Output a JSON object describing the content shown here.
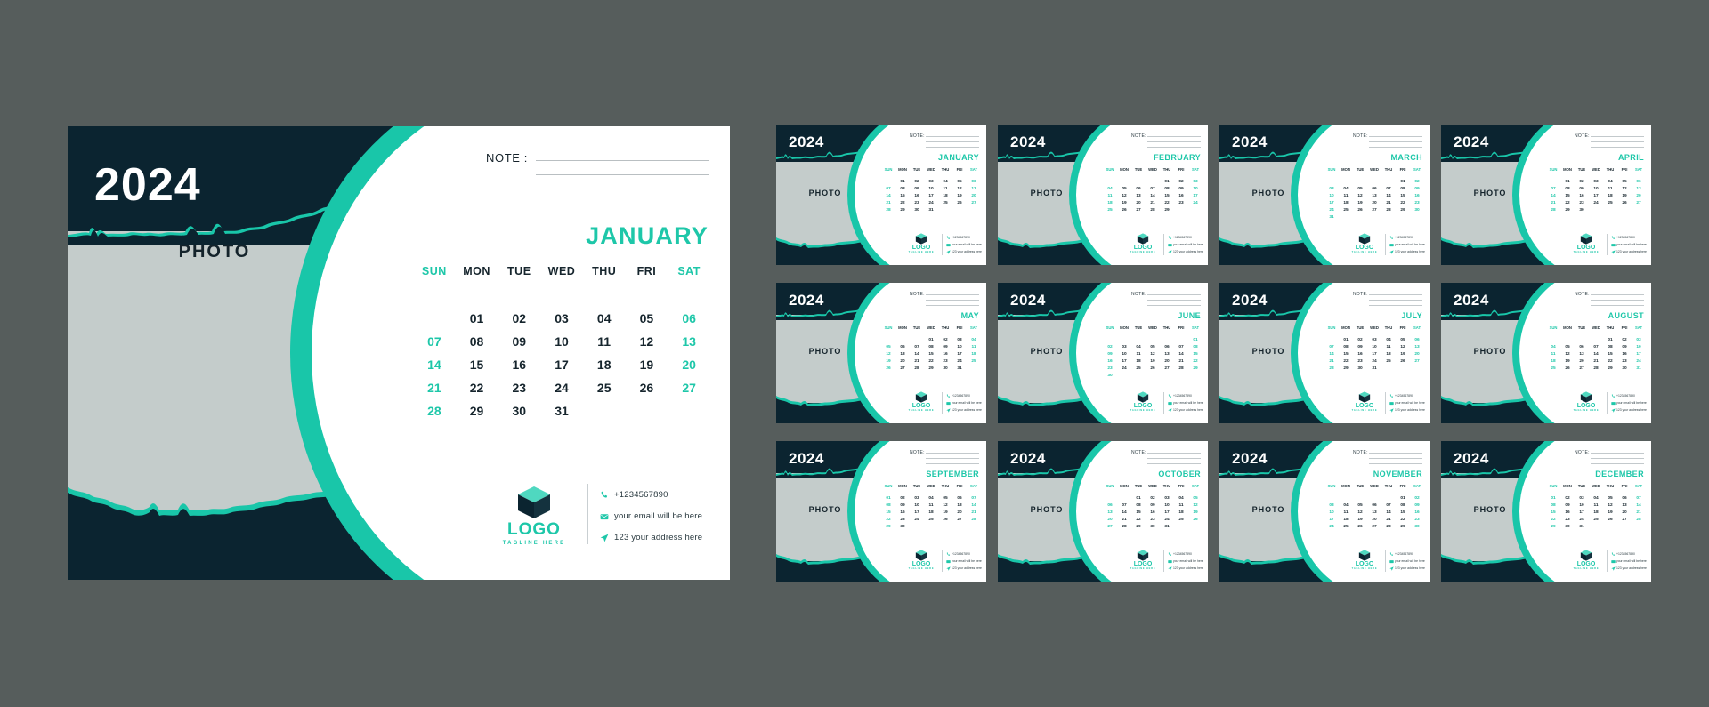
{
  "theme": {
    "background": "#565d5c",
    "dark_navy": "#0b2430",
    "teal": "#19c6a9",
    "teal_text": "#1ec7a9",
    "photo_gray": "#c4cccb",
    "paper": "#ffffff"
  },
  "main": {
    "year": "2024",
    "photo_label": "PHOTO",
    "note_label": "NOTE :",
    "month": "JANUARY",
    "weekdays": [
      "SUN",
      "MON",
      "TUE",
      "WED",
      "THU",
      "FRI",
      "SAT"
    ],
    "weekend_indices": [
      0,
      6
    ],
    "days": [
      "",
      "01",
      "02",
      "03",
      "04",
      "05",
      "06",
      "07",
      "08",
      "09",
      "10",
      "11",
      "12",
      "13",
      "14",
      "15",
      "16",
      "17",
      "18",
      "19",
      "20",
      "21",
      "22",
      "23",
      "24",
      "25",
      "26",
      "27",
      "28",
      "29",
      "30",
      "31",
      "",
      "",
      ""
    ],
    "logo": {
      "icon": "cube-icon",
      "word": "LOGO",
      "tagline": "TAGLINE HERE"
    },
    "contacts": [
      {
        "icon": "phone-icon",
        "text": "+1234567890"
      },
      {
        "icon": "envelope-icon",
        "text": "your email will be here"
      },
      {
        "icon": "location-arrow-icon",
        "text": "123 your address here"
      }
    ],
    "note_lines": 3
  },
  "thumbnails": [
    {
      "year": "2024",
      "photo_label": "PHOTO",
      "note_label": "NOTE:",
      "month": "JANUARY",
      "days": [
        "",
        "01",
        "02",
        "03",
        "04",
        "05",
        "06",
        "07",
        "08",
        "09",
        "10",
        "11",
        "12",
        "13",
        "14",
        "15",
        "16",
        "17",
        "18",
        "19",
        "20",
        "21",
        "22",
        "23",
        "24",
        "25",
        "26",
        "27",
        "28",
        "29",
        "30",
        "31",
        "",
        "",
        ""
      ]
    },
    {
      "year": "2024",
      "photo_label": "PHOTO",
      "note_label": "NOTE:",
      "month": "FEBRUARY",
      "days": [
        "",
        "",
        "",
        "",
        "01",
        "02",
        "03",
        "04",
        "05",
        "06",
        "07",
        "08",
        "09",
        "10",
        "11",
        "12",
        "13",
        "14",
        "15",
        "16",
        "17",
        "18",
        "19",
        "20",
        "21",
        "22",
        "23",
        "24",
        "25",
        "26",
        "27",
        "28",
        "29",
        "",
        ""
      ]
    },
    {
      "year": "2024",
      "photo_label": "PHOTO",
      "note_label": "NOTE:",
      "month": "MARCH",
      "days": [
        "",
        "",
        "",
        "",
        "",
        "01",
        "02",
        "03",
        "04",
        "05",
        "06",
        "07",
        "08",
        "09",
        "10",
        "11",
        "12",
        "13",
        "14",
        "15",
        "16",
        "17",
        "18",
        "19",
        "20",
        "21",
        "22",
        "23",
        "24",
        "25",
        "26",
        "27",
        "28",
        "29",
        "30",
        "31",
        "",
        "",
        "",
        "",
        ""
      ]
    },
    {
      "year": "2024",
      "photo_label": "PHOTO",
      "note_label": "NOTE:",
      "month": "APRIL",
      "days": [
        "",
        "01",
        "02",
        "03",
        "04",
        "05",
        "06",
        "07",
        "08",
        "09",
        "10",
        "11",
        "12",
        "13",
        "14",
        "15",
        "16",
        "17",
        "18",
        "19",
        "20",
        "21",
        "22",
        "23",
        "24",
        "25",
        "26",
        "27",
        "28",
        "29",
        "30",
        "",
        "",
        "",
        ""
      ]
    },
    {
      "year": "2024",
      "photo_label": "PHOTO",
      "note_label": "NOTE:",
      "month": "MAY",
      "days": [
        "",
        "",
        "",
        "01",
        "02",
        "03",
        "04",
        "05",
        "06",
        "07",
        "08",
        "09",
        "10",
        "11",
        "12",
        "13",
        "14",
        "15",
        "16",
        "17",
        "18",
        "19",
        "20",
        "21",
        "22",
        "23",
        "24",
        "25",
        "26",
        "27",
        "28",
        "29",
        "30",
        "31",
        ""
      ]
    },
    {
      "year": "2024",
      "photo_label": "PHOTO",
      "note_label": "NOTE:",
      "month": "JUNE",
      "days": [
        "",
        "",
        "",
        "",
        "",
        "",
        "01",
        "02",
        "03",
        "04",
        "05",
        "06",
        "07",
        "08",
        "09",
        "10",
        "11",
        "12",
        "13",
        "14",
        "15",
        "16",
        "17",
        "18",
        "19",
        "20",
        "21",
        "22",
        "23",
        "24",
        "25",
        "26",
        "27",
        "28",
        "29",
        "30",
        "",
        "",
        "",
        "",
        ""
      ]
    },
    {
      "year": "2024",
      "photo_label": "PHOTO",
      "note_label": "NOTE:",
      "month": "JULY",
      "days": [
        "",
        "01",
        "02",
        "03",
        "04",
        "05",
        "06",
        "07",
        "08",
        "09",
        "10",
        "11",
        "12",
        "13",
        "14",
        "15",
        "16",
        "17",
        "18",
        "19",
        "20",
        "21",
        "22",
        "23",
        "24",
        "25",
        "26",
        "27",
        "28",
        "29",
        "30",
        "31",
        "",
        "",
        ""
      ]
    },
    {
      "year": "2024",
      "photo_label": "PHOTO",
      "note_label": "NOTE:",
      "month": "AUGUST",
      "days": [
        "",
        "",
        "",
        "",
        "01",
        "02",
        "03",
        "04",
        "05",
        "06",
        "07",
        "08",
        "09",
        "10",
        "11",
        "12",
        "13",
        "14",
        "15",
        "16",
        "17",
        "18",
        "19",
        "20",
        "21",
        "22",
        "23",
        "24",
        "25",
        "26",
        "27",
        "28",
        "29",
        "30",
        "31"
      ]
    },
    {
      "year": "2024",
      "photo_label": "PHOTO",
      "note_label": "NOTE:",
      "month": "SEPTEMBER",
      "days": [
        "01",
        "02",
        "03",
        "04",
        "05",
        "06",
        "07",
        "08",
        "09",
        "10",
        "11",
        "12",
        "13",
        "14",
        "15",
        "16",
        "17",
        "18",
        "19",
        "20",
        "21",
        "22",
        "23",
        "24",
        "25",
        "26",
        "27",
        "28",
        "29",
        "30",
        "",
        "",
        "",
        "",
        ""
      ]
    },
    {
      "year": "2024",
      "photo_label": "PHOTO",
      "note_label": "NOTE:",
      "month": "OCTOBER",
      "days": [
        "",
        "",
        "01",
        "02",
        "03",
        "04",
        "05",
        "06",
        "07",
        "08",
        "09",
        "10",
        "11",
        "12",
        "13",
        "14",
        "15",
        "16",
        "17",
        "18",
        "19",
        "20",
        "21",
        "22",
        "23",
        "24",
        "25",
        "26",
        "27",
        "28",
        "29",
        "30",
        "31",
        "",
        ""
      ]
    },
    {
      "year": "2024",
      "photo_label": "PHOTO",
      "note_label": "NOTE:",
      "month": "NOVEMBER",
      "days": [
        "",
        "",
        "",
        "",
        "",
        "01",
        "02",
        "03",
        "04",
        "05",
        "06",
        "07",
        "08",
        "09",
        "10",
        "11",
        "12",
        "13",
        "14",
        "15",
        "16",
        "17",
        "18",
        "19",
        "20",
        "21",
        "22",
        "23",
        "24",
        "25",
        "26",
        "27",
        "28",
        "29",
        "30",
        "",
        "",
        "",
        "",
        "",
        ""
      ]
    },
    {
      "year": "2024",
      "photo_label": "PHOTO",
      "note_label": "NOTE:",
      "month": "DECEMBER",
      "days": [
        "01",
        "02",
        "03",
        "04",
        "05",
        "06",
        "07",
        "08",
        "09",
        "10",
        "11",
        "12",
        "13",
        "14",
        "15",
        "16",
        "17",
        "18",
        "19",
        "20",
        "21",
        "22",
        "23",
        "24",
        "25",
        "26",
        "27",
        "28",
        "29",
        "30",
        "31",
        "",
        "",
        "",
        ""
      ]
    }
  ]
}
